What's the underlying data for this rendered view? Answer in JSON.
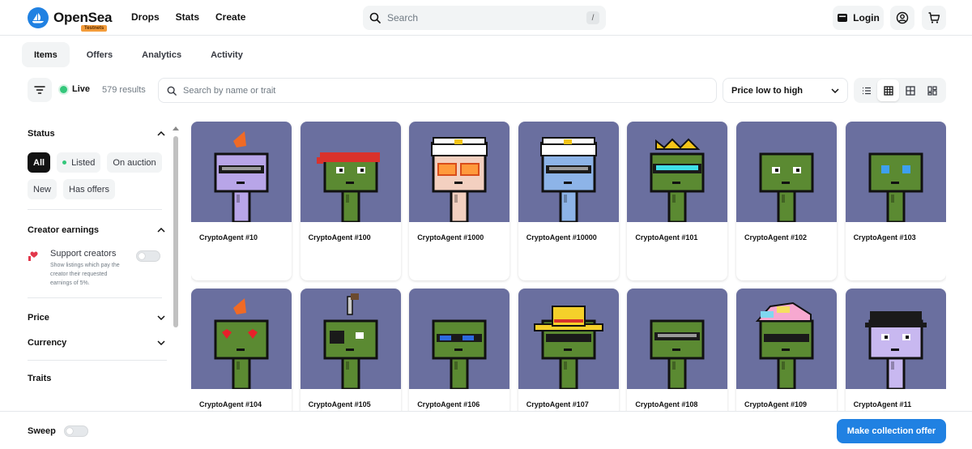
{
  "brand": {
    "name": "OpenSea",
    "badge": "Testnets",
    "color": "#2081e2"
  },
  "nav": {
    "items": [
      "Drops",
      "Stats",
      "Create"
    ]
  },
  "search": {
    "placeholder": "Search",
    "shortcut": "/"
  },
  "header_actions": {
    "login_label": "Login",
    "icons": [
      "wallet-icon",
      "account-icon",
      "cart-icon"
    ]
  },
  "tabs": [
    {
      "label": "Items",
      "active": true
    },
    {
      "label": "Offers",
      "active": false
    },
    {
      "label": "Analytics",
      "active": false
    },
    {
      "label": "Activity",
      "active": false
    }
  ],
  "filterbar": {
    "live_label": "Live",
    "results": "579 results",
    "trait_placeholder": "Search by name or trait",
    "sort_label": "Price low to high"
  },
  "sidebar": {
    "status_title": "Status",
    "status_chips": [
      {
        "label": "All",
        "active": true
      },
      {
        "label": "Listed",
        "active": false,
        "dot": true
      },
      {
        "label": "On auction",
        "active": false
      },
      {
        "label": "New",
        "active": false
      },
      {
        "label": "Has offers",
        "active": false
      }
    ],
    "creator_title": "Creator earnings",
    "support_label": "Support creators",
    "support_desc": "Show listings which pay the creator their requested earnings of 5%.",
    "price_title": "Price",
    "currency_title": "Currency",
    "traits_title": "Traits"
  },
  "items": [
    {
      "name": "CryptoAgent #10",
      "skin": "#b8a5e8",
      "hat": "orange-mohawk",
      "eyes": "visor"
    },
    {
      "name": "CryptoAgent #100",
      "skin": "#5b8a32",
      "hat": "red-bandana",
      "eyes": "normal"
    },
    {
      "name": "CryptoAgent #1000",
      "skin": "#f3d0c0",
      "hat": "captain",
      "eyes": "orange-glasses"
    },
    {
      "name": "CryptoAgent #10000",
      "skin": "#8db4e8",
      "hat": "captain",
      "eyes": "visor"
    },
    {
      "name": "CryptoAgent #101",
      "skin": "#5b8a32",
      "hat": "gold-crown",
      "eyes": "cyan-visor"
    },
    {
      "name": "CryptoAgent #102",
      "skin": "#5b8a32",
      "hat": "none",
      "eyes": "normal"
    },
    {
      "name": "CryptoAgent #103",
      "skin": "#5b8a32",
      "hat": "none",
      "eyes": "blue"
    },
    {
      "name": "CryptoAgent #104",
      "skin": "#5b8a32",
      "hat": "orange-mohawk",
      "eyes": "hearts"
    },
    {
      "name": "CryptoAgent #105",
      "skin": "#5b8a32",
      "hat": "knife",
      "eyes": "eyepatch"
    },
    {
      "name": "CryptoAgent #106",
      "skin": "#5b8a32",
      "hat": "none",
      "eyes": "blue-shades"
    },
    {
      "name": "CryptoAgent #107",
      "skin": "#5b8a32",
      "hat": "sombrero",
      "eyes": "shades"
    },
    {
      "name": "CryptoAgent #108",
      "skin": "#5b8a32",
      "hat": "none",
      "eyes": "visor"
    },
    {
      "name": "CryptoAgent #109",
      "skin": "#5b8a32",
      "hat": "rainbow",
      "eyes": "shades"
    },
    {
      "name": "CryptoAgent #11",
      "skin": "#c8b8f0",
      "hat": "bowler",
      "eyes": "normal"
    }
  ],
  "bottom": {
    "sweep_label": "Sweep",
    "offer_label": "Make collection offer"
  }
}
